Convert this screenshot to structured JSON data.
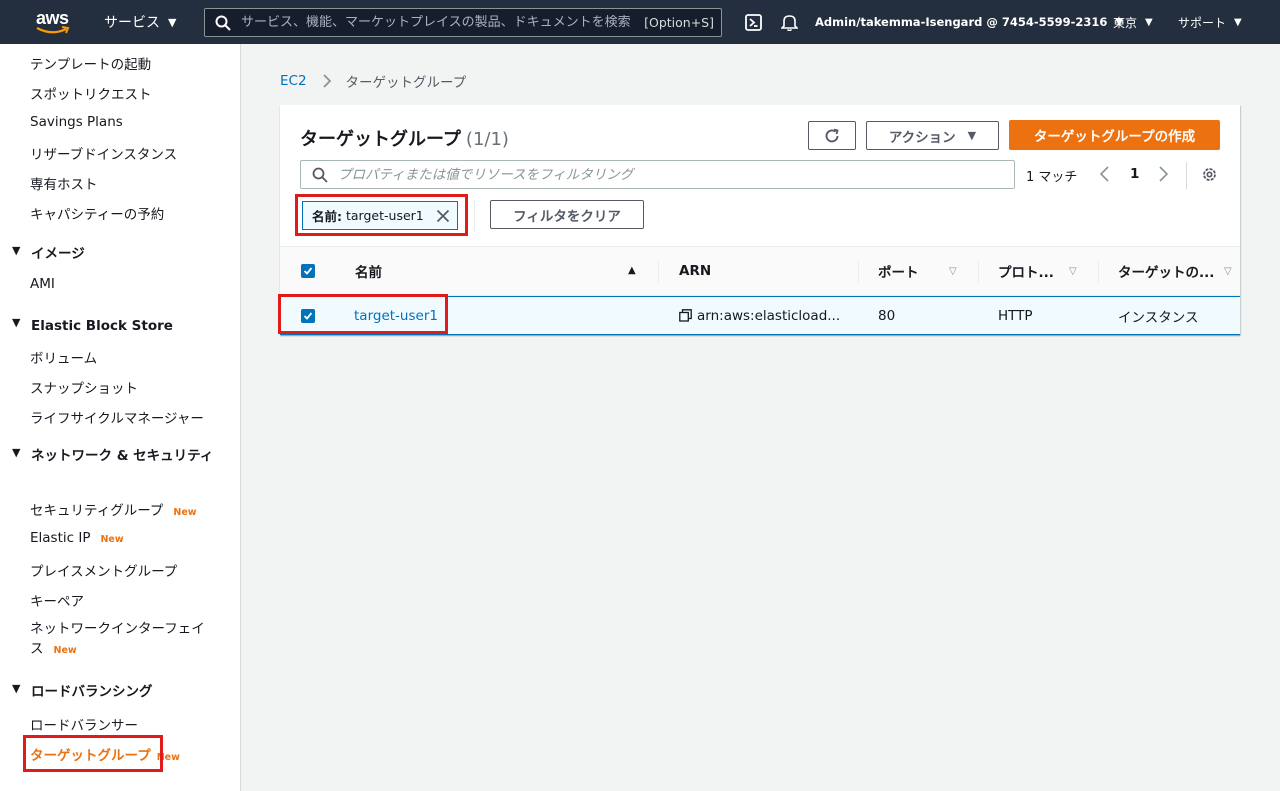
{
  "topnav": {
    "logo": "aws",
    "services": "サービス",
    "search_placeholder": "サービス、機能、マーケットプレイスの製品、ドキュメントを検索",
    "search_shortcut": "[Option+S]",
    "account": "Admin/takemma-Isengard @ 7454-5599-2316",
    "region": "東京",
    "support": "サポート"
  },
  "sidebar": {
    "items": [
      "テンプレートの起動",
      "スポットリクエスト",
      "Savings Plans",
      "リザーブドインスタンス",
      "専有ホスト",
      "キャパシティーの予約"
    ],
    "images_head": "イメージ",
    "ami": "AMI",
    "ebs_head": "Elastic Block Store",
    "ebs_items": [
      "ボリューム",
      "スナップショット",
      "ライフサイクルマネージャー"
    ],
    "net_head": "ネットワーク & セキュリティ",
    "security_groups": "セキュリティグループ",
    "elastic_ip": "Elastic IP",
    "placement_groups": "プレイスメントグループ",
    "key_pairs": "キーペア",
    "network_interfaces": "ネットワークインターフェイス",
    "new_badge": "New",
    "lb_head": "ロードバランシング",
    "load_balancers": "ロードバランサー",
    "target_groups": "ターゲットグループ"
  },
  "breadcrumb": {
    "root": "EC2",
    "current": "ターゲットグループ"
  },
  "panel": {
    "title": "ターゲットグループ",
    "count": "(1/1)",
    "actions": "アクション",
    "create": "ターゲットグループの作成",
    "filter_placeholder": "プロパティまたは値でリソースをフィルタリング",
    "matches": "1 マッチ",
    "page": "1",
    "token_label": "名前:",
    "token_value": "target-user1",
    "clear_filters": "フィルタをクリア"
  },
  "table": {
    "columns": [
      "名前",
      "ARN",
      "ポート",
      "プロト...",
      "ターゲットの..."
    ],
    "rows": [
      {
        "name": "target-user1",
        "arn": "arn:aws:elasticload...",
        "port": "80",
        "protocol": "HTTP",
        "target_type": "インスタンス"
      }
    ]
  },
  "colors": {
    "nav_bg": "#232f3e",
    "primary": "#ec7211",
    "link": "#0073bb",
    "highlight": "#e11a1a"
  }
}
